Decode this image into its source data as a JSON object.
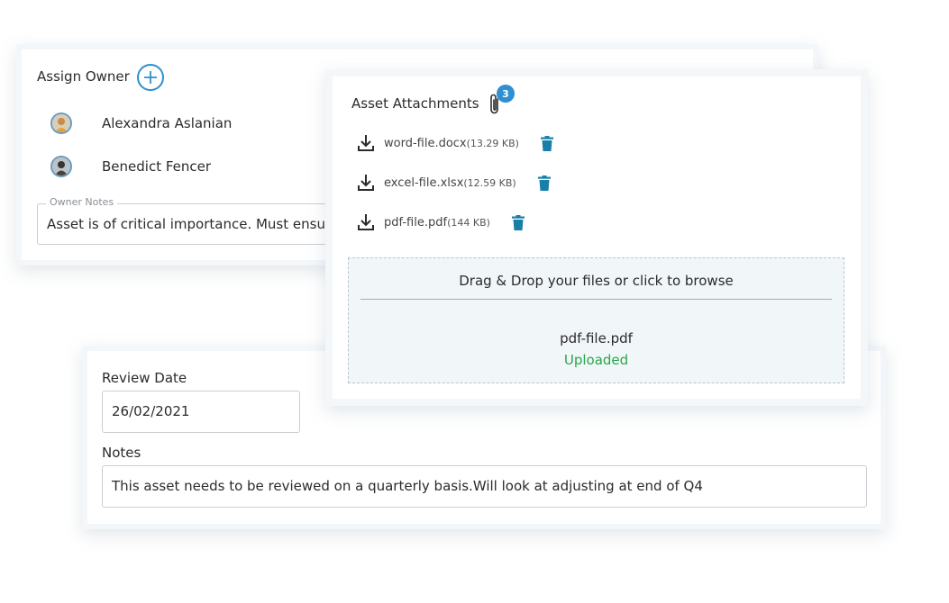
{
  "owner": {
    "title": "Assign Owner",
    "owners": [
      {
        "name": "Alexandra Aslanian"
      },
      {
        "name": "Benedict Fencer"
      }
    ],
    "notes_legend": "Owner Notes",
    "notes_value": "Asset is of critical importance. Must ensure"
  },
  "attachments": {
    "title": "Asset Attachments",
    "count": "3",
    "files": [
      {
        "name": "word-file.docx",
        "size": "(13.29 KB)"
      },
      {
        "name": "excel-file.xlsx",
        "size": "(12.59 KB)"
      },
      {
        "name": "pdf-file.pdf",
        "size": "(144 KB)"
      }
    ],
    "dropzone_text": "Drag & Drop your files or click to browse",
    "uploaded_file": "pdf-file.pdf",
    "uploaded_status": "Uploaded"
  },
  "review": {
    "date_label": "Review Date",
    "date_value": "26/02/2021",
    "notes_label": "Notes",
    "notes_value": "This asset needs to be reviewed on a quarterly basis.Will look at adjusting at end of Q4"
  },
  "colors": {
    "accent": "#2f8fd0",
    "trash": "#1a7fa8",
    "success": "#2aa64a"
  },
  "icons": [
    "plus-icon",
    "paperclip-icon",
    "download-icon",
    "trash-icon"
  ]
}
